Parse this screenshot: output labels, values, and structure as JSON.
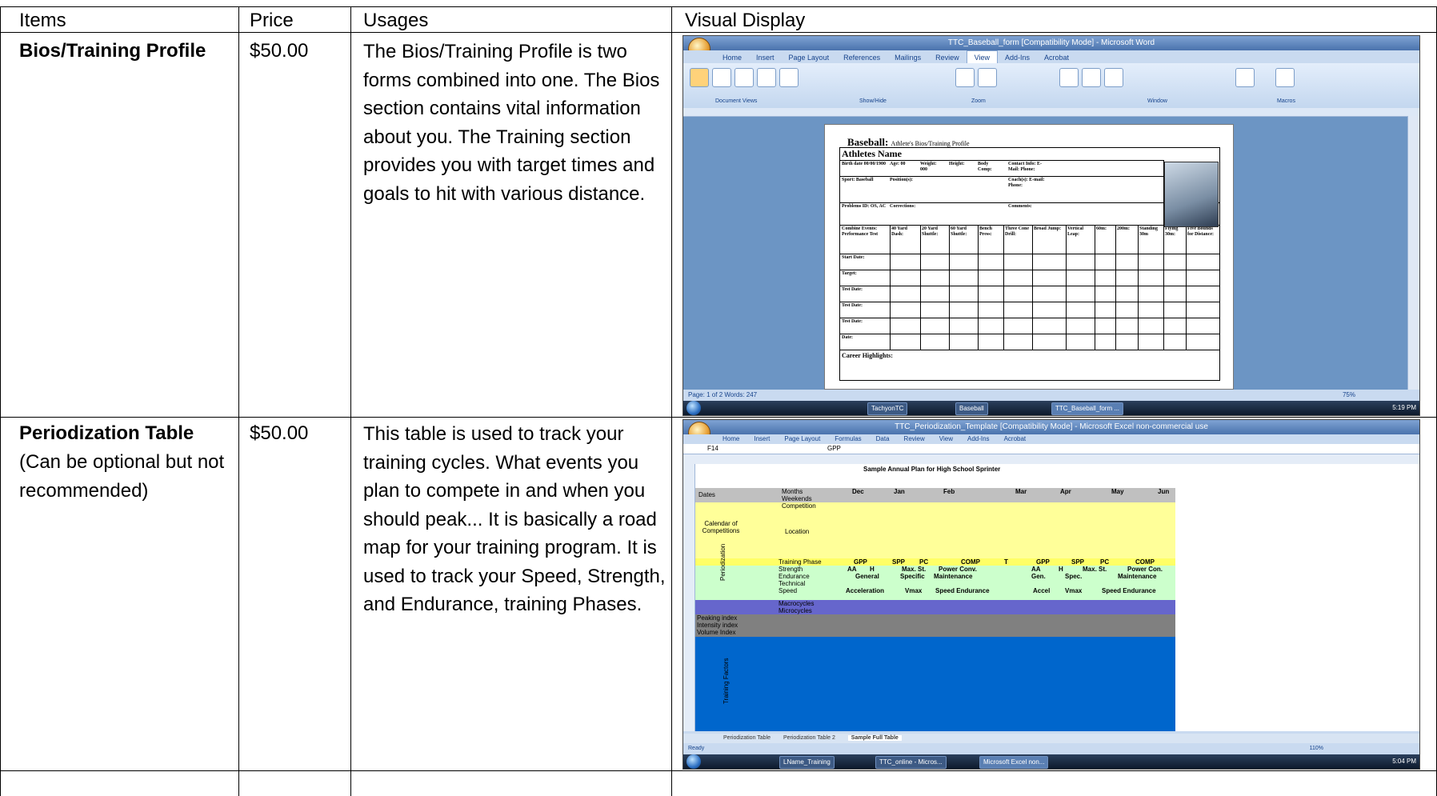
{
  "table": {
    "headers": {
      "items": "Items",
      "price": "Price",
      "usages": "Usages",
      "visual": "Visual Display"
    },
    "rows": [
      {
        "item": "Bios/Training Profile",
        "note": "",
        "price": "$50.00",
        "usage": "The Bios/Training Profile is two forms combined into one. The Bios section contains vital information about you.  The Training section provides you with target times and goals to hit with various distance."
      },
      {
        "item": "Periodization Table",
        "note": "(Can be optional but not recommended)",
        "price": "$50.00",
        "usage": "This table is used to track your training cycles. What events you plan to compete in and when you should peak... It is basically a road map for your training program. It is used to track your Speed, Strength, and Endurance, training Phases."
      }
    ]
  },
  "word_shot": {
    "window_title": "TTC_Baseball_form [Compatibility Mode] - Microsoft Word",
    "tabs": [
      "Home",
      "Insert",
      "Page Layout",
      "References",
      "Mailings",
      "Review",
      "View",
      "Add-Ins",
      "Acrobat"
    ],
    "active_tab": "View",
    "ribbon_groups": [
      "Document Views",
      "Show/Hide",
      "Zoom",
      "Window",
      "Macros"
    ],
    "doc_heading": "Baseball:",
    "doc_subheading": "Athlete's Bios/Training Profile",
    "athlete_name": "Athletes Name",
    "fields": [
      "Birth date 00/00/1900",
      "Age: 00",
      "Weight: 000",
      "Height:",
      "Body Comp:",
      "Contact Info: E-Mail: Phone:",
      "Sport: Baseball",
      "Position(s):",
      "Coach(s): E-mail: Phone:",
      "Problems ID: OS, AC",
      "Corrections:",
      "Comments:"
    ],
    "test_headers": [
      "Combine Events: Performance Test",
      "40 Yard Dash:",
      "20 Yard Shuttle:",
      "60 Yard Shuttle:",
      "Bench Press:",
      "Three Cone Drill:",
      "Broad Jump:",
      "Vertical Leap:",
      "60m:",
      "200m:",
      "Standing 30m",
      "Flying 30m:",
      "Five Bounds for Distance:"
    ],
    "row_labels": [
      "Start Date:",
      "Target:",
      "Test Date:",
      "Test Date:",
      "Test Date:",
      "Date:"
    ],
    "career": "Career Highlights:",
    "status": "Page: 1 of 2   Words: 247",
    "zoom": "75%",
    "taskbar_items": [
      "TachyonTC",
      "Baseball",
      "TTC_Baseball_form ..."
    ],
    "clock": "5:19 PM"
  },
  "excel_shot": {
    "window_title": "TTC_Periodization_Template [Compatibility Mode] - Microsoft Excel non-commercial use",
    "tabs": [
      "Home",
      "Insert",
      "Page Layout",
      "Formulas",
      "Data",
      "Review",
      "View",
      "Add-Ins",
      "Acrobat"
    ],
    "name_box": "F14",
    "formula": "GPP",
    "sheet_title": "Sample Annual Plan for High School Sprinter",
    "months": [
      "Dec",
      "Jan",
      "Feb",
      "Mar",
      "Apr",
      "May",
      "Jun"
    ],
    "labels": [
      "Dates",
      "Months",
      "Weekends",
      "Competition",
      "Calendar of Competitions",
      "Location",
      "Training Phase",
      "Strength",
      "Endurance",
      "Technical",
      "Speed",
      "Macrocycles",
      "Microcycles",
      "Peaking index",
      "Intensity index",
      "Volume Index",
      "Periodization",
      "Training Factors"
    ],
    "phases": [
      "GPP",
      "SPP",
      "PC",
      "COMP",
      "T",
      "GPP",
      "SPP",
      "PC",
      "COMP"
    ],
    "strength": [
      "AA",
      "H",
      "Max. St.",
      "Power Conv.",
      "AA",
      "H",
      "Max. St.",
      "Power Con."
    ],
    "endurance": [
      "General",
      "Specific",
      "Maintenance",
      "Gen.",
      "Spec.",
      "Maintenance"
    ],
    "speed": [
      "Acceleration",
      "Vmax",
      "Speed Endurance",
      "Accel",
      "Vmax",
      "Speed Endurance"
    ],
    "sheet_tabs": [
      "Periodization Table",
      "Periodization Table 2",
      "Sample Full Table"
    ],
    "status": "Ready",
    "zoom": "110%",
    "taskbar_items": [
      "LName_Training",
      "TTC_online - Micros...",
      "Microsoft Excel non..."
    ],
    "clock": "5:04 PM"
  },
  "colors": {
    "ribbon": "#c9daf0",
    "excel_yellow": "#ffff99",
    "excel_green": "#ccffcc",
    "excel_blue": "#0066cc",
    "excel_purple": "#6666cc",
    "excel_gray": "#808080"
  }
}
